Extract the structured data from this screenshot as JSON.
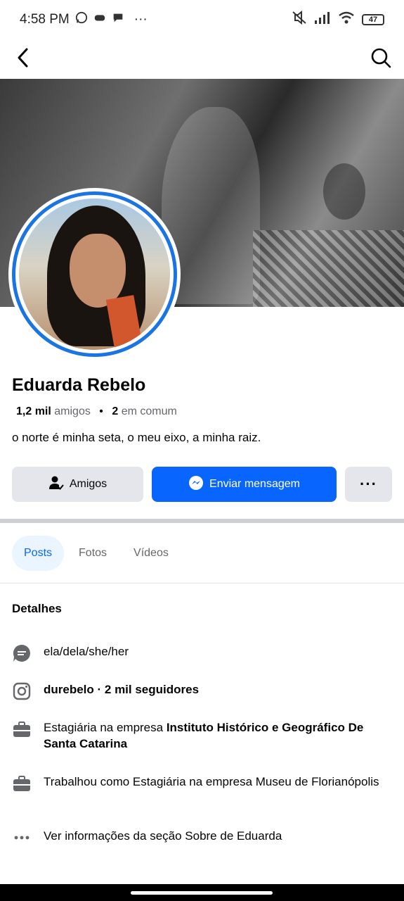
{
  "status_bar": {
    "time": "4:58 PM",
    "dots": "···",
    "battery": "47",
    "icons": [
      "whatsapp-icon",
      "game-icon",
      "chat-icon",
      "mute-icon",
      "signal-icon",
      "wifi-icon",
      "battery-icon"
    ]
  },
  "nav": {
    "icons": [
      "back-arrow-icon",
      "search-icon"
    ]
  },
  "profile": {
    "name": "Eduarda Rebelo",
    "friends_count": "1,2 mil",
    "friends_label": "amigos",
    "separator": "•",
    "mutual_count": "2",
    "mutual_label": "em comum",
    "bio": "o norte é minha seta, o meu eixo, a minha raiz."
  },
  "actions": {
    "friends_label": "Amigos",
    "message_label": "Enviar mensagem",
    "more_label": "···"
  },
  "tabs": [
    {
      "label": "Posts",
      "active": true
    },
    {
      "label": "Fotos",
      "active": false
    },
    {
      "label": "Vídeos",
      "active": false
    }
  ],
  "details": {
    "title": "Detalhes",
    "pronouns": "ela/dela/she/her",
    "instagram": "durebelo · 2 mil seguidores",
    "job1_prefix": "Estagiária na empresa ",
    "job1_company": "Instituto Histórico e Geográfico De Santa Catarina",
    "job2": "Trabalhou como Estagiária na empresa Museu de Florianópolis",
    "about": "Ver informações da seção Sobre de Eduarda"
  },
  "colors": {
    "accent": "#0866ff",
    "avatar_ring": "#1b74e4",
    "button_gray": "#e4e6eb",
    "tab_active_bg": "#ebf5ff"
  }
}
